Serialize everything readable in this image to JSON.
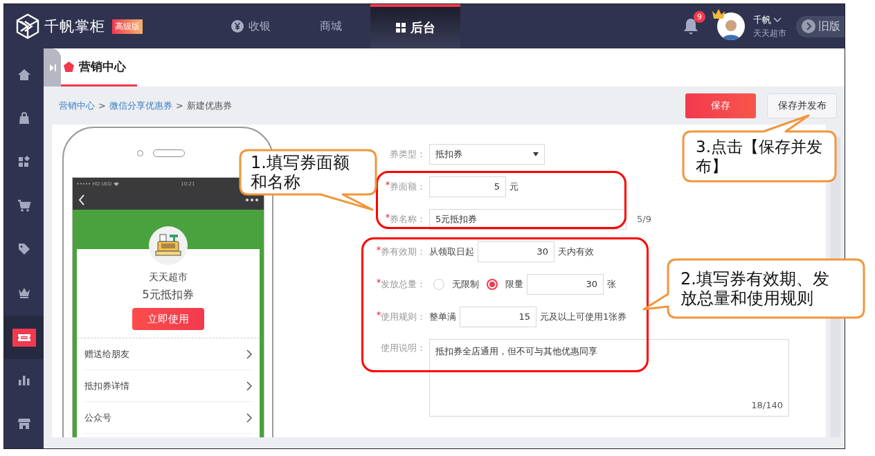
{
  "header": {
    "logo": "千帆掌柜",
    "edition": "高级版",
    "tabs": [
      {
        "label": "收银",
        "kind": "yen",
        "selected": false
      },
      {
        "label": "商城",
        "kind": "plain",
        "selected": false
      },
      {
        "label": "后台",
        "kind": "grid",
        "selected": true
      }
    ],
    "notifications": "9",
    "user": {
      "name": "千帆",
      "store": "天天超市"
    },
    "old_version": "旧版"
  },
  "sidebar": {
    "items": [
      {
        "kind": "home",
        "selected": false
      },
      {
        "kind": "bag",
        "selected": false
      },
      {
        "kind": "apps",
        "selected": false
      },
      {
        "kind": "cart",
        "selected": false
      },
      {
        "kind": "tag",
        "selected": false
      },
      {
        "kind": "crown",
        "selected": false
      },
      {
        "kind": "ticket",
        "selected": true
      },
      {
        "kind": "chart",
        "selected": false
      },
      {
        "kind": "store",
        "selected": false
      }
    ]
  },
  "page_tab": {
    "label": "营销中心"
  },
  "breadcrumb": {
    "separator": ">",
    "items": [
      {
        "label": "营销中心",
        "link": true
      },
      {
        "label": "微信分享优惠券",
        "link": true
      },
      {
        "label": "新建优惠券",
        "link": false
      }
    ]
  },
  "actions": [
    {
      "label": "保存",
      "kind": "primary"
    },
    {
      "label": "保存并发布",
      "kind": "secondary"
    }
  ],
  "preview": {
    "status": "••••• HD UED",
    "time": "10:21",
    "store": "天天超市",
    "coupon": "5元抵扣券",
    "use_button": "立即使用",
    "menu": [
      "赠送给朋友",
      "抵扣券详情",
      "公众号"
    ]
  },
  "form": {
    "rows": [
      {
        "kind": "select",
        "label": "券类型：",
        "required": false,
        "value": "抵扣券"
      },
      {
        "kind": "number",
        "label": "券面额：",
        "required": true,
        "value": "5",
        "suffix": "元"
      },
      {
        "kind": "text",
        "label": "券名称：",
        "required": true,
        "value": "5元抵扣券",
        "counter": "5/9"
      },
      {
        "kind": "number",
        "label": "券有效期：",
        "required": true,
        "prefix": "从领取日起",
        "value": "30",
        "suffix": "天内有效"
      },
      {
        "kind": "radio",
        "label": "发放总量：",
        "required": true,
        "options": [
          {
            "label": "无限制",
            "selected": false
          },
          {
            "label": "限量",
            "selected": true
          }
        ],
        "value": "30",
        "suffix": "张"
      },
      {
        "kind": "number",
        "label": "使用规则：",
        "required": true,
        "prefix": "整单满",
        "value": "15",
        "suffix": "元及以上可使用1张券"
      },
      {
        "kind": "textarea",
        "label": "使用说明：",
        "required": false,
        "value": "抵扣券全店通用，但不可与其他优惠同享",
        "counter": "18/140"
      }
    ]
  },
  "callouts": [
    {
      "text": "3.点击【保存并发布】"
    },
    {
      "text": "1.填写券面额和名称"
    },
    {
      "text": "2.填写券有效期、发放总量和使用规则"
    }
  ]
}
